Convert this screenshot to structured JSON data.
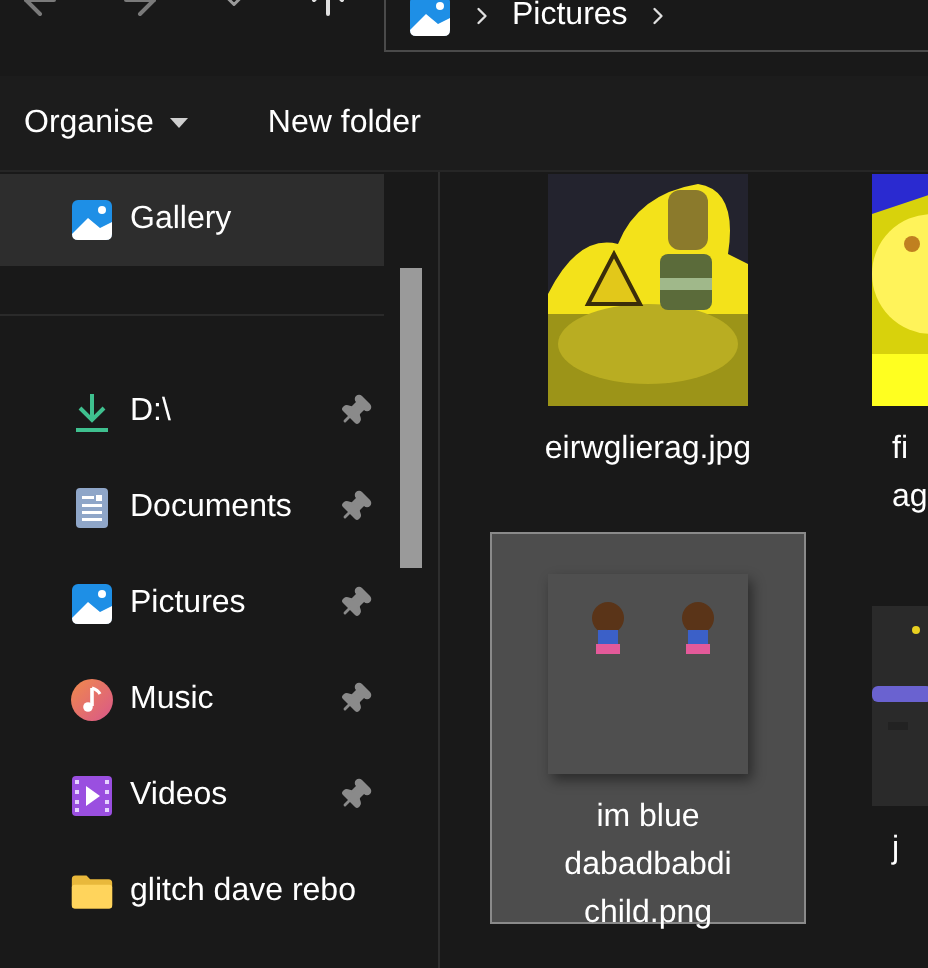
{
  "address_bar": {
    "location": "Pictures"
  },
  "toolbar": {
    "buttons": [
      {
        "label": "Organise",
        "kind": "menu"
      },
      {
        "label": "New folder",
        "kind": "plain"
      }
    ]
  },
  "sidebar": {
    "top_items": [
      {
        "label": "Gallery",
        "selected": true
      }
    ],
    "quick_access": [
      {
        "label": "D:\\",
        "pinned": true
      },
      {
        "label": "Documents",
        "pinned": true
      },
      {
        "label": "Pictures",
        "pinned": true
      },
      {
        "label": "Music",
        "pinned": true
      },
      {
        "label": "Videos",
        "pinned": true
      },
      {
        "label": "glitch dave rebo",
        "pinned": false
      }
    ]
  },
  "files": [
    {
      "name_lines": [
        "eirwglierag.jpg"
      ],
      "selected": false
    },
    {
      "name_lines": [
        "fi",
        "ag"
      ],
      "selected": false
    },
    {
      "name_lines": [
        "im blue",
        "dabadbabdi",
        "child.png"
      ],
      "selected": true
    },
    {
      "name_lines": [
        "j"
      ],
      "selected": false
    }
  ]
}
